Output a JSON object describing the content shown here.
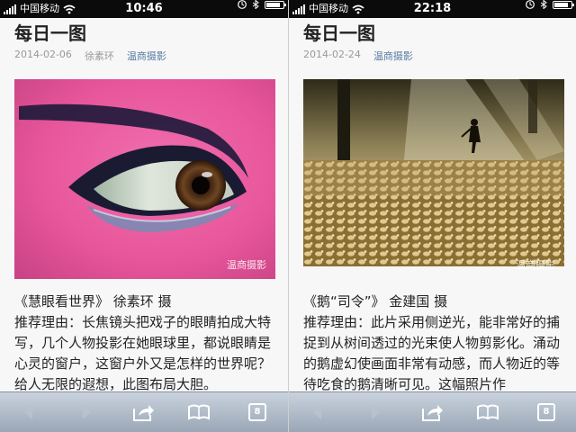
{
  "left": {
    "status": {
      "carrier": "中国移动",
      "time": "10:46",
      "battery_level": 0.85
    },
    "article": {
      "title": "每日一图",
      "date": "2014-02-06",
      "author": "徐素环",
      "source": "温商摄影",
      "watermark": "温商摄影",
      "caption": "《慧眼看世界》 徐素环 摄",
      "reason": "推荐理由：长焦镜头把戏子的眼睛拍成大特写，几个人物投影在她眼球里，都说眼睛是心灵的窗户，这窗户外又是怎样的世界呢？给人无限的遐想，此图布局大胆。"
    },
    "toolbar": {
      "tab_count": "8"
    }
  },
  "right": {
    "status": {
      "carrier": "中国移动",
      "time": "22:18",
      "battery_level": 0.85
    },
    "article": {
      "title": "每日一图",
      "date": "2014-02-24",
      "author": "",
      "source": "温商摄影",
      "watermark": "温商摄影",
      "caption": "《鹅“司令”》 金建国 摄",
      "reason": "推荐理由：此片采用侧逆光，能非常好的捕捉到从树间透过的光束使人物剪影化。涌动的鹅虚幻使画面非常有动感，而人物近的等待吃食的鹅清晰可见。这幅照片作"
    },
    "toolbar": {
      "tab_count": "8"
    }
  },
  "colors": {
    "status_bar": "#0b0b0b",
    "toolbar": "#9aa7b6",
    "link": "#5a7ca6",
    "eye_pink": "#e8569a"
  },
  "icons": [
    "signal-icon",
    "wifi-icon",
    "lock-icon",
    "bluetooth-icon",
    "battery-icon",
    "back-icon",
    "forward-icon",
    "share-icon",
    "bookmarks-icon",
    "tabs-icon"
  ]
}
